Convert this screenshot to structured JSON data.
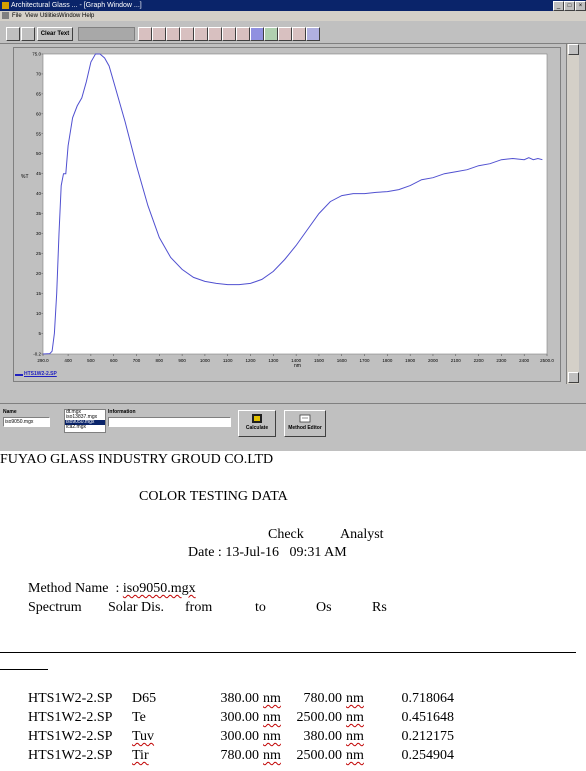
{
  "window": {
    "title": "Architectural Glass ... - [Graph Window ...]",
    "menu": [
      "File",
      "View",
      "Utilities",
      "Window",
      "Help"
    ],
    "clear_button": "Clear Text"
  },
  "chart_data": {
    "type": "line",
    "x": [
      290,
      320,
      330,
      340,
      350,
      360,
      370,
      380,
      390,
      400,
      420,
      440,
      460,
      480,
      500,
      520,
      540,
      560,
      580,
      600,
      650,
      700,
      750,
      800,
      850,
      900,
      950,
      1000,
      1050,
      1100,
      1150,
      1200,
      1250,
      1300,
      1350,
      1400,
      1450,
      1500,
      1550,
      1600,
      1650,
      1700,
      1750,
      1800,
      1850,
      1900,
      1950,
      2000,
      2050,
      2100,
      2150,
      2200,
      2250,
      2300,
      2350,
      2400,
      2420,
      2440,
      2460,
      2480,
      2500
    ],
    "series": [
      {
        "values": [
          -0.2,
          -0.1,
          0.5,
          5,
          15,
          30,
          42,
          45,
          45,
          52,
          59,
          62,
          64,
          68,
          73,
          75,
          75,
          74,
          72,
          68,
          58,
          47,
          37,
          29,
          24,
          21,
          19,
          18,
          17.5,
          17.2,
          17.2,
          17.5,
          18.5,
          20.5,
          23.5,
          27,
          31,
          35,
          38,
          39.5,
          40,
          40,
          40.3,
          40.5,
          41,
          42,
          43.5,
          44,
          45,
          45.5,
          46,
          47,
          47.5,
          48.5,
          48.8,
          48.5,
          49,
          48.5,
          48.8,
          48.5
        ]
      }
    ],
    "xlabel": "nm",
    "ylabel": "%T",
    "xlim": [
      290,
      2500
    ],
    "ylim": [
      -0.2,
      75
    ],
    "xticks": [
      "290.0",
      "400",
      "500",
      "600",
      "700",
      "800",
      "900",
      "1000",
      "1100",
      "1200",
      "1300",
      "1400",
      "1500",
      "1600",
      "1700",
      "1800",
      "1900",
      "2000",
      "2100",
      "2200",
      "2300",
      "2400",
      "2500.0"
    ],
    "yticks": [
      "75.0",
      "70",
      "65",
      "60",
      "55",
      "50",
      "45",
      "40",
      "35",
      "30",
      "25",
      "20",
      "15",
      "10",
      "5",
      "-0.2"
    ],
    "legend": "HTS1W2-2.SP",
    "color": "#5050d0",
    "grid": false
  },
  "panel": {
    "name_label": "Name",
    "name_value": "iso9050.mgx",
    "list_items": [
      "dt.mgx",
      "iso13837.mgx",
      "iso9050.mgx",
      "lca2.mgx"
    ],
    "info_label": "Information",
    "calculate_label": "Calculate",
    "method_editor_label": "Method Editor"
  },
  "report": {
    "company": "FUYAO GLASS INDUSTRY GROUD CO.LTD",
    "title": "COLOR TESTING DATA",
    "check_label": "Check",
    "analyst_label": "Analyst",
    "date_line": "Date : 13-Jul-16   09:31 AM",
    "method_label": "Method Name  : ",
    "method_value": "iso9050.mgx",
    "headers": [
      "Spectrum",
      "Solar Dis.",
      "from",
      "to",
      "Os",
      "Rs"
    ],
    "rows": [
      {
        "spectrum": "HTS1W2-2.SP",
        "solar": "D65",
        "from": "380.00",
        "to": "780.00",
        "value": "0.718064"
      },
      {
        "spectrum": "HTS1W2-2.SP",
        "solar": "Te",
        "from": "300.00",
        "to": "2500.00",
        "value": "0.451648"
      },
      {
        "spectrum": "HTS1W2-2.SP",
        "solar": "Tuv",
        "from": "300.00",
        "to": "380.00",
        "value": "0.212175"
      },
      {
        "spectrum": "HTS1W2-2.SP",
        "solar": "Tir",
        "from": "780.00",
        "to": "2500.00",
        "value": "0.254904"
      }
    ],
    "unit": "nm"
  }
}
